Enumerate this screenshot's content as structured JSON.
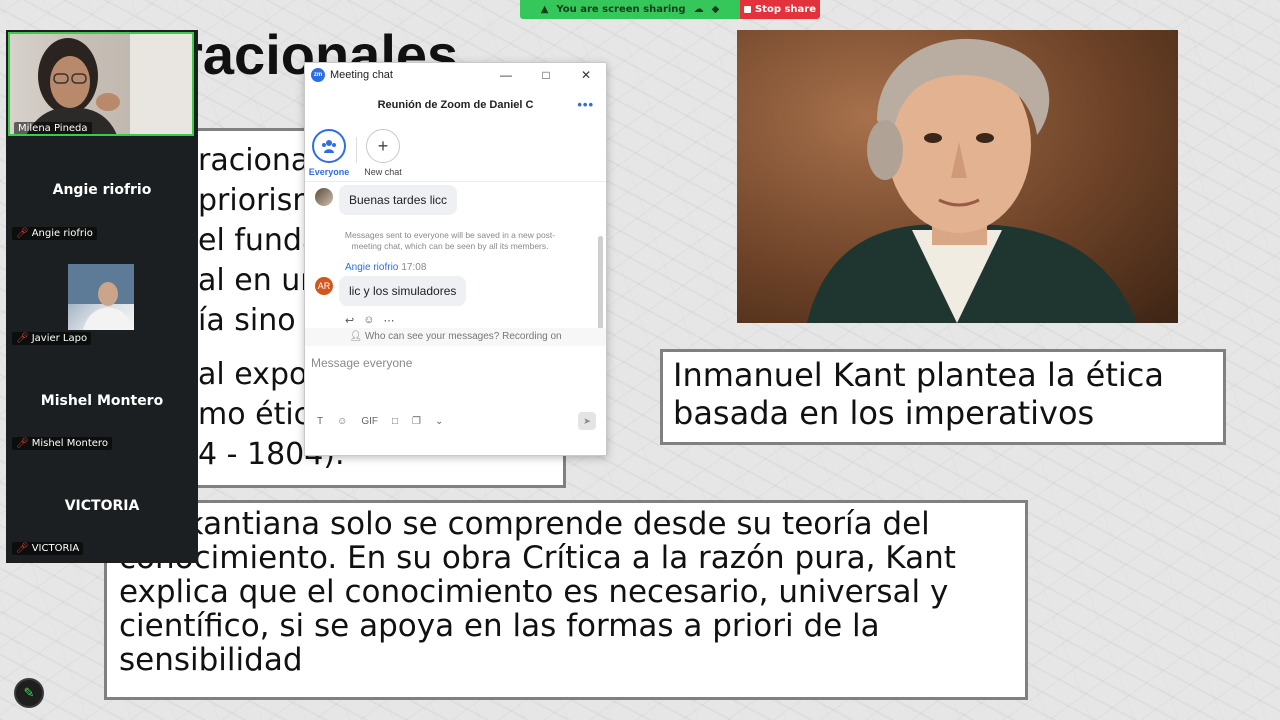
{
  "slide": {
    "title": "l racionales",
    "box1_lines": [
      "racional",
      "priorism",
      "el funda",
      "al en un",
      "ía sino e"
    ],
    "box1_lines2": [
      "al expon",
      "mo étic",
      "4 - 1804)."
    ],
    "box2_text": "Inmanuel Kant plantea la ética basada en los imperativos",
    "box3_text": "tica kantiana solo se comprende desde su teoría del conocimiento. En su obra Crítica a la razón pura, Kant explica que el conocimiento es necesario, universal y científico, si se apoya en las formas a priori de la sensibilidad"
  },
  "share_bar": {
    "status": "You are screen sharing",
    "stop_label": "Stop share",
    "colors": {
      "sharing": "#35c759",
      "stop": "#e3323c"
    }
  },
  "participants": [
    {
      "name": "Milena Pineda",
      "tile": "video"
    },
    {
      "name": "Angie riofrio",
      "display": "Angie riofrio",
      "tile": "name"
    },
    {
      "name": "Javier Lapo",
      "tile": "thumbnail"
    },
    {
      "name": "Mishel Montero",
      "display": "Mishel Montero",
      "tile": "name"
    },
    {
      "name": "VICTORIA",
      "display": "VICTORIA",
      "tile": "name"
    }
  ],
  "chat": {
    "window_title": "Meeting chat",
    "app_icon": "zm",
    "header": "Reunión de Zoom de Daniel C",
    "tabs": [
      {
        "label": "Everyone",
        "icon": "people-icon",
        "active": true
      },
      {
        "label": "New chat",
        "icon": "plus-icon",
        "active": false
      }
    ],
    "messages": [
      {
        "text": "Buenas tardes licc"
      },
      {
        "system": "Messages sent to everyone will be saved in a new post-meeting chat, which can be seen by all its members."
      },
      {
        "sender": "Angie riofrio",
        "time": "17:08",
        "initials": "AR",
        "text": "lic y los simuladores"
      }
    ],
    "notice": "Who can see your messages? Recording on",
    "input_placeholder": "Message everyone",
    "accent": "#2d6ee6"
  }
}
